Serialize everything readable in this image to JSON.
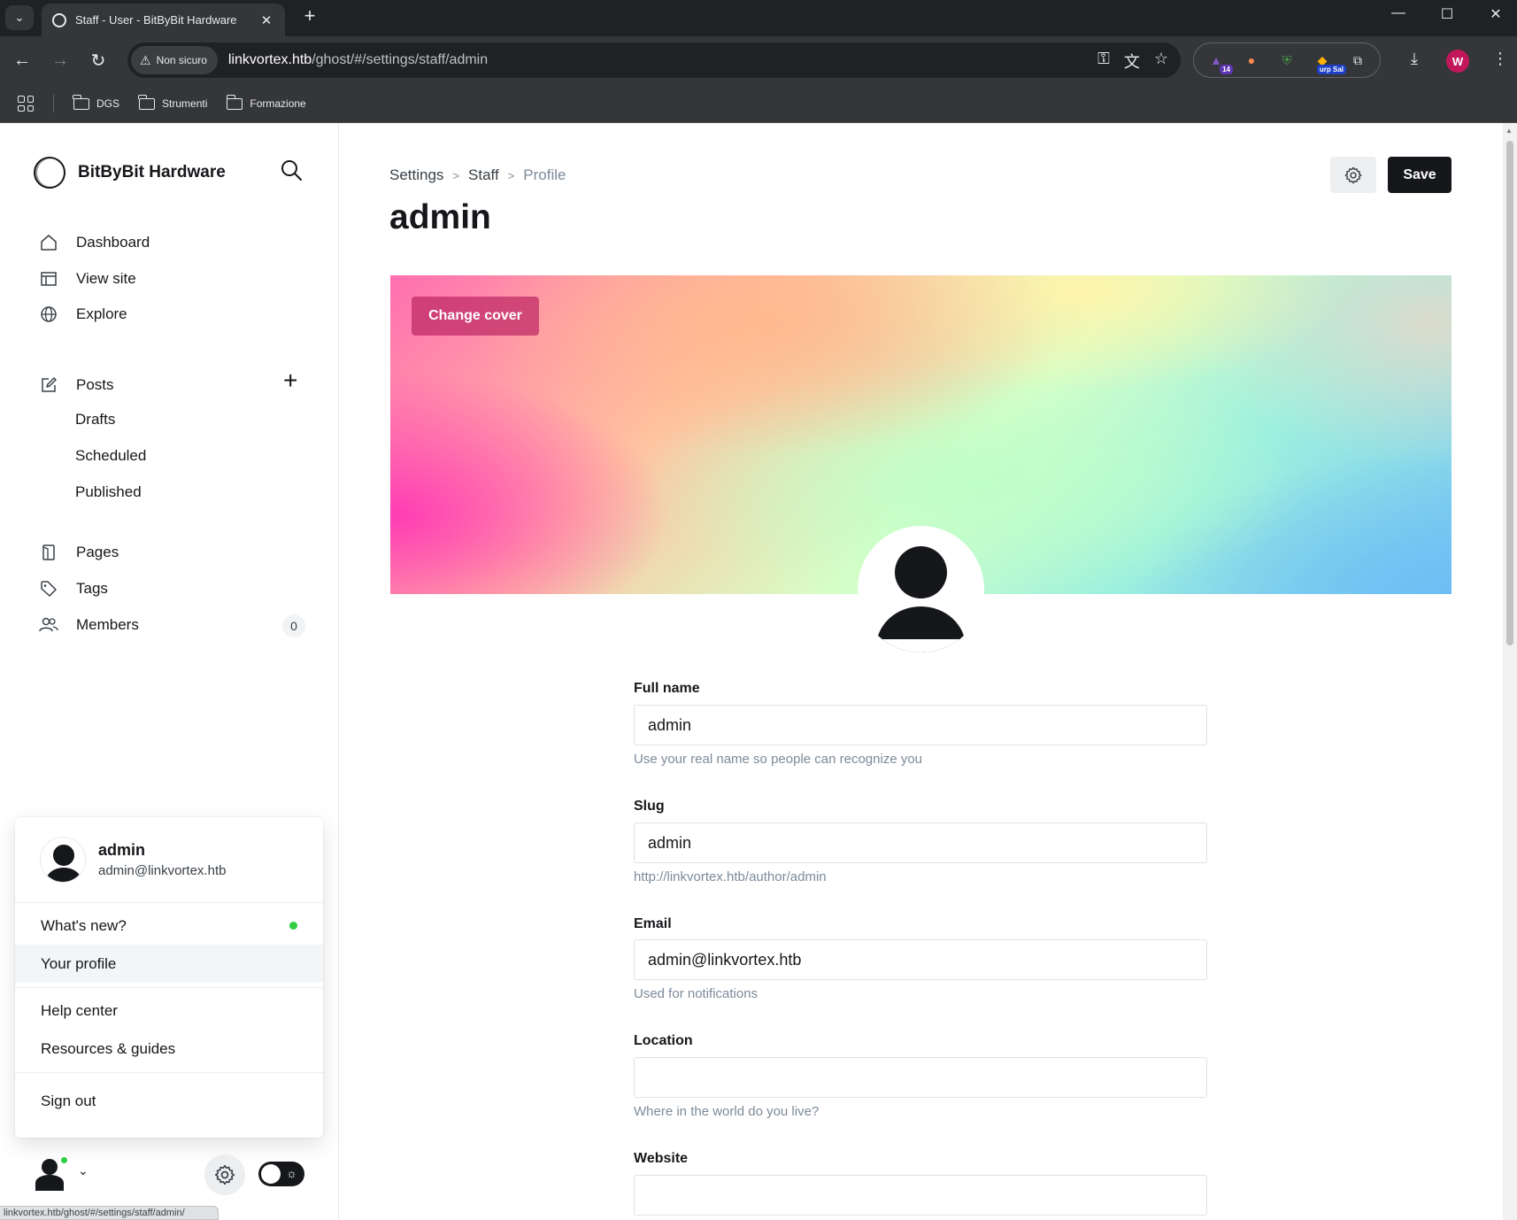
{
  "browser": {
    "tab_title": "Staff - User - BitByBit Hardware",
    "security_label": "Non sicuro",
    "url_host": "linkvortex.htb",
    "url_path": "/ghost/#/settings/staff/admin",
    "extension_badge": "14",
    "extension_badge2": "urp Sal",
    "profile_initial": "W",
    "bookmarks": [
      "DGS",
      "Strumenti",
      "Formazione"
    ],
    "status_url": "linkvortex.htb/ghost/#/settings/staff/admin/"
  },
  "sidebar": {
    "site_name": "BitByBit Hardware",
    "nav": {
      "dashboard": "Dashboard",
      "view_site": "View site",
      "explore": "Explore",
      "posts": "Posts",
      "drafts": "Drafts",
      "scheduled": "Scheduled",
      "published": "Published",
      "pages": "Pages",
      "tags": "Tags",
      "members": "Members",
      "members_count": "0"
    },
    "menu": {
      "user_name": "admin",
      "user_email": "admin@linkvortex.htb",
      "whats_new": "What's new?",
      "your_profile": "Your profile",
      "help_center": "Help center",
      "resources": "Resources & guides",
      "sign_out": "Sign out"
    }
  },
  "main": {
    "breadcrumb": [
      "Settings",
      "Staff",
      "Profile"
    ],
    "title": "admin",
    "save_label": "Save",
    "change_cover_label": "Change cover",
    "fields": {
      "full_name": {
        "label": "Full name",
        "value": "admin",
        "hint": "Use your real name so people can recognize you"
      },
      "slug": {
        "label": "Slug",
        "value": "admin",
        "hint": "http://linkvortex.htb/author/admin"
      },
      "email": {
        "label": "Email",
        "value": "admin@linkvortex.htb",
        "hint": "Used for notifications"
      },
      "location": {
        "label": "Location",
        "value": "",
        "hint": "Where in the world do you live?"
      },
      "website": {
        "label": "Website",
        "value": ""
      }
    }
  },
  "colors": {
    "brand_dark": "#15171a",
    "online_dot": "#30cf43",
    "browser_frame": "#35363a"
  }
}
